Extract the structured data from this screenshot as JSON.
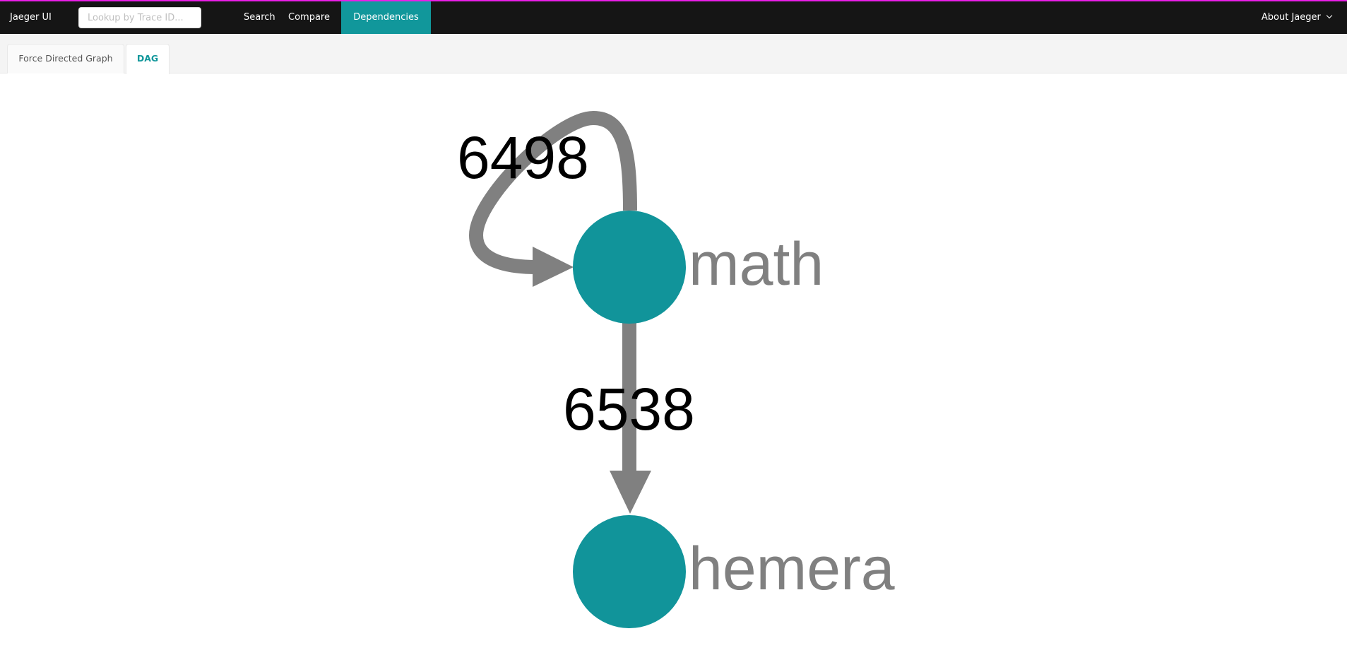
{
  "header": {
    "brand": "Jaeger UI",
    "lookup_placeholder": "Lookup by Trace ID...",
    "nav": [
      {
        "label": "Search"
      },
      {
        "label": "Compare"
      },
      {
        "label": "Dependencies",
        "active": true
      }
    ],
    "about_label": "About Jaeger",
    "about_icon": "chevron-down-icon"
  },
  "tabs": [
    {
      "label": "Force Directed Graph"
    },
    {
      "label": "DAG",
      "active": true
    }
  ],
  "graph": {
    "node_color": "#11949a",
    "edge_color": "#808080",
    "nodes": [
      {
        "id": "math",
        "label": "math"
      },
      {
        "id": "hemera",
        "label": "hemera"
      }
    ],
    "edges": [
      {
        "from": "math",
        "to": "math",
        "label": "6498"
      },
      {
        "from": "math",
        "to": "hemera",
        "label": "6538"
      }
    ]
  }
}
